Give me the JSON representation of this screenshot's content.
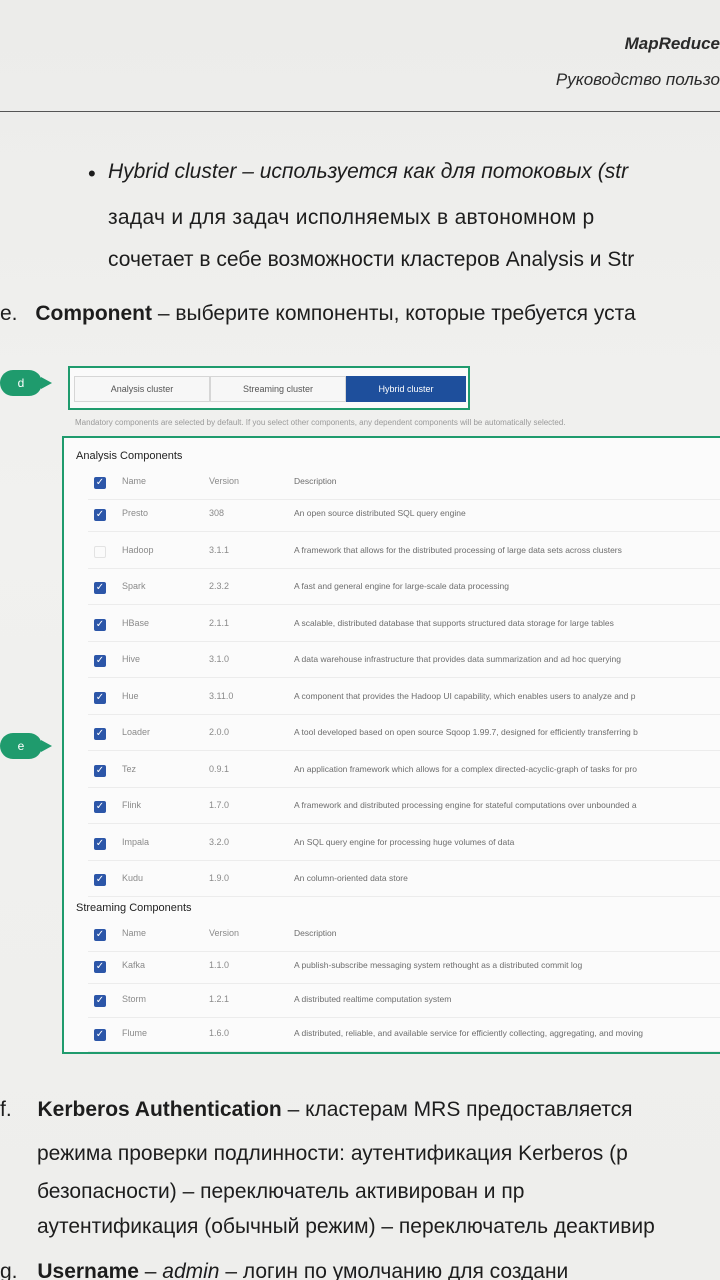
{
  "header": {
    "title": "MapReduce",
    "subtitle": "Руководство пользо"
  },
  "body": {
    "bullet_line1": "Hybrid cluster – используется как для потоковых (str",
    "bullet_line2": "задач  и  для  задач  исполняемых  в  автономном  р",
    "bullet_line3": "сочетает в себе возможности кластеров Analysis и Str",
    "item_e_marker": "e.",
    "item_e_term": "Component",
    "item_e_text": " – выберите компоненты, которые требуется уста",
    "item_f_marker": "f.",
    "item_f_term": "Kerberos  Authentication",
    "item_f_text": "  –  кластерам  MRS  предоставляется",
    "f_line2": "режима  проверки  подлинности:  аутентификация  Kerberos  (р",
    "f_line3": "безопасности)     –     переключатель     активирован     и     пр",
    "f_line4": "аутентификация (обычный режим) – переключатель деактивир",
    "item_g_marker": "g.",
    "item_g_term": "Username",
    "item_g_dash": " – ",
    "item_g_value": "admin",
    "item_g_text": " – логин по умолчанию для создани"
  },
  "badges": {
    "d": "d",
    "e": "e"
  },
  "tabs": [
    {
      "label": "Analysis cluster",
      "active": false
    },
    {
      "label": "Streaming cluster",
      "active": false
    },
    {
      "label": "Hybrid cluster",
      "active": true
    }
  ],
  "mandatory_note": "Mandatory components are selected by default. If you select other components, any dependent components will be automatically selected.",
  "analysis": {
    "title": "Analysis Components",
    "headers": {
      "name": "Name",
      "version": "Version",
      "description": "Description"
    },
    "rows": [
      {
        "checked": true,
        "name": "Presto",
        "version": "308",
        "description": "An open source distributed SQL query engine"
      },
      {
        "checked": false,
        "name": "Hadoop",
        "version": "3.1.1",
        "description": "A framework that allows for the distributed processing of large data sets across clusters"
      },
      {
        "checked": true,
        "name": "Spark",
        "version": "2.3.2",
        "description": "A fast and general engine for large-scale data processing"
      },
      {
        "checked": true,
        "name": "HBase",
        "version": "2.1.1",
        "description": "A scalable, distributed database that supports structured data storage for large tables"
      },
      {
        "checked": true,
        "name": "Hive",
        "version": "3.1.0",
        "description": "A data warehouse infrastructure that provides data summarization and ad hoc querying"
      },
      {
        "checked": true,
        "name": "Hue",
        "version": "3.11.0",
        "description": "A component that provides the Hadoop UI capability, which enables users to analyze and p"
      },
      {
        "checked": true,
        "name": "Loader",
        "version": "2.0.0",
        "description": "A tool developed based on open source Sqoop 1.99.7, designed for efficiently transferring b"
      },
      {
        "checked": true,
        "name": "Tez",
        "version": "0.9.1",
        "description": "An application framework which allows for a complex directed-acyclic-graph of tasks for pro"
      },
      {
        "checked": true,
        "name": "Flink",
        "version": "1.7.0",
        "description": "A framework and distributed processing engine for stateful computations over unbounded a"
      },
      {
        "checked": true,
        "name": "Impala",
        "version": "3.2.0",
        "description": "An SQL query engine for processing huge volumes of data"
      },
      {
        "checked": true,
        "name": "Kudu",
        "version": "1.9.0",
        "description": "An column-oriented data store"
      }
    ]
  },
  "streaming": {
    "title": "Streaming Components",
    "headers": {
      "name": "Name",
      "version": "Version",
      "description": "Description"
    },
    "rows": [
      {
        "checked": true,
        "name": "Kafka",
        "version": "1.1.0",
        "description": "A publish-subscribe messaging system rethought as a distributed commit log"
      },
      {
        "checked": true,
        "name": "Storm",
        "version": "1.2.1",
        "description": "A distributed realtime computation system"
      },
      {
        "checked": true,
        "name": "Flume",
        "version": "1.6.0",
        "description": "A distributed, reliable, and available service for efficiently collecting, aggregating, and moving"
      }
    ]
  },
  "colors": {
    "accent": "#1f9b6d",
    "checkbox": "#2c56a8",
    "active_tab": "#1e4f9c"
  }
}
